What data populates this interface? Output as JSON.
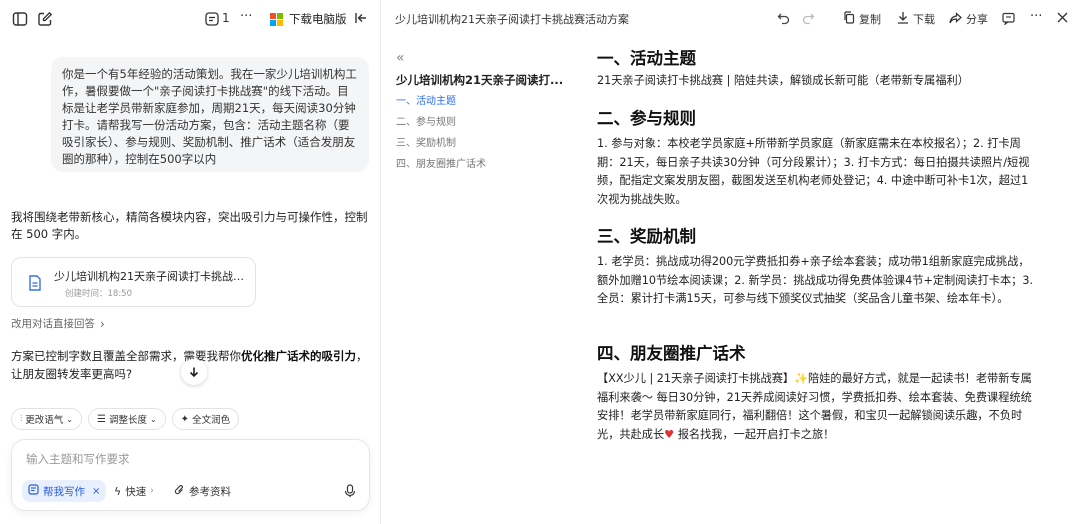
{
  "left_toolbar": {
    "history_count": "1",
    "more": "···",
    "download_desktop": "下载电脑版"
  },
  "conversation": {
    "user_prompt": "你是一个有5年经验的活动策划。我在一家少儿培训机构工作，暑假要做一个\"亲子阅读打卡挑战赛\"的线下活动。目标是让老学员带新家庭参加，周期21天，每天阅读30分钟打卡。请帮我写一份活动方案，包含：活动主题名称（要吸引家长）、参与规则、奖励机制、推广话术（适合发朋友圈的那种），控制在500字以内",
    "ai_reply": "我将围绕老带新核心，精简各模块内容，突出吸引力与可操作性，控制在 500 字内。",
    "doc_card": {
      "title": "少儿培训机构21天亲子阅读打卡挑战赛活动方案",
      "time": "创建时间：18:50"
    },
    "switch_link": "改用对话直接回答",
    "suggestion_pre": "方案已控制字数且覆盖全部需求，需要我帮你",
    "suggestion_bold": "优化推广话术的吸引力",
    "suggestion_post": "，让朋友圈转发率更高吗?"
  },
  "chips": [
    {
      "icon": "tune-icon",
      "label": "更改语气"
    },
    {
      "icon": "list-icon",
      "label": "调整长度"
    },
    {
      "icon": "sparkle-icon",
      "label": "全文润色"
    }
  ],
  "input": {
    "placeholder": "输入主题和写作要求",
    "tool_write": "帮我写作",
    "tool_fast": "快速",
    "tool_ref": "参考资料"
  },
  "right_toolbar": {
    "doc_title": "少儿培训机构21天亲子阅读打卡挑战赛活动方案",
    "copy": "复制",
    "download": "下载",
    "share": "分享",
    "more": "···"
  },
  "toc": {
    "title": "少儿培训机构21天亲子阅读打...",
    "items": [
      "一、活动主题",
      "二、参与规则",
      "三、奖励机制",
      "四、朋友圈推广话术"
    ]
  },
  "document": {
    "s1_heading": "一、活动主题",
    "s1_body": "21天亲子阅读打卡挑战赛 | 陪娃共读，解锁成长新可能（老带新专属福利）",
    "s2_heading": "二、参与规则",
    "s2_body": "1. 参与对象：本校老学员家庭+所带新学员家庭（新家庭需未在本校报名）；2. 打卡周期：21天，每日亲子共读30分钟（可分段累计）；3. 打卡方式：每日拍摄共读照片/短视频，配指定文案发朋友圈，截图发送至机构老师处登记；4. 中途中断可补卡1次，超过1次视为挑战失败。",
    "s3_heading": "三、奖励机制",
    "s3_body": "1. 老学员：挑战成功得200元学费抵扣券+亲子绘本套装；成功带1组新家庭完成挑战，额外加赠10节绘本阅读课；2. 新学员：挑战成功得免费体验课4节+定制阅读打卡本；3. 全员：累计打卡满15天，可参与线下颁奖仪式抽奖（奖品含儿童书架、绘本年卡）。",
    "s4_heading": "四、朋友圈推广话术",
    "s4_body_a": "【XX少儿 | 21天亲子阅读打卡挑战赛】",
    "s4_body_b": "陪娃的最好方式，就是一起读书！老带新专属福利来袭～ 每日30分钟，21天养成阅读好习惯，学费抵扣券、绘本套装、免费课程统统安排！老学员带新家庭同行，福利翻倍！这个暑假，和宝贝一起解锁阅读乐趣，不负时光，共赴成长",
    "s4_body_c": " 报名找我，一起开启打卡之旅！"
  },
  "colors": {
    "accent_blue": "#2a6df4",
    "bubble_bg": "#f4f5f7"
  }
}
